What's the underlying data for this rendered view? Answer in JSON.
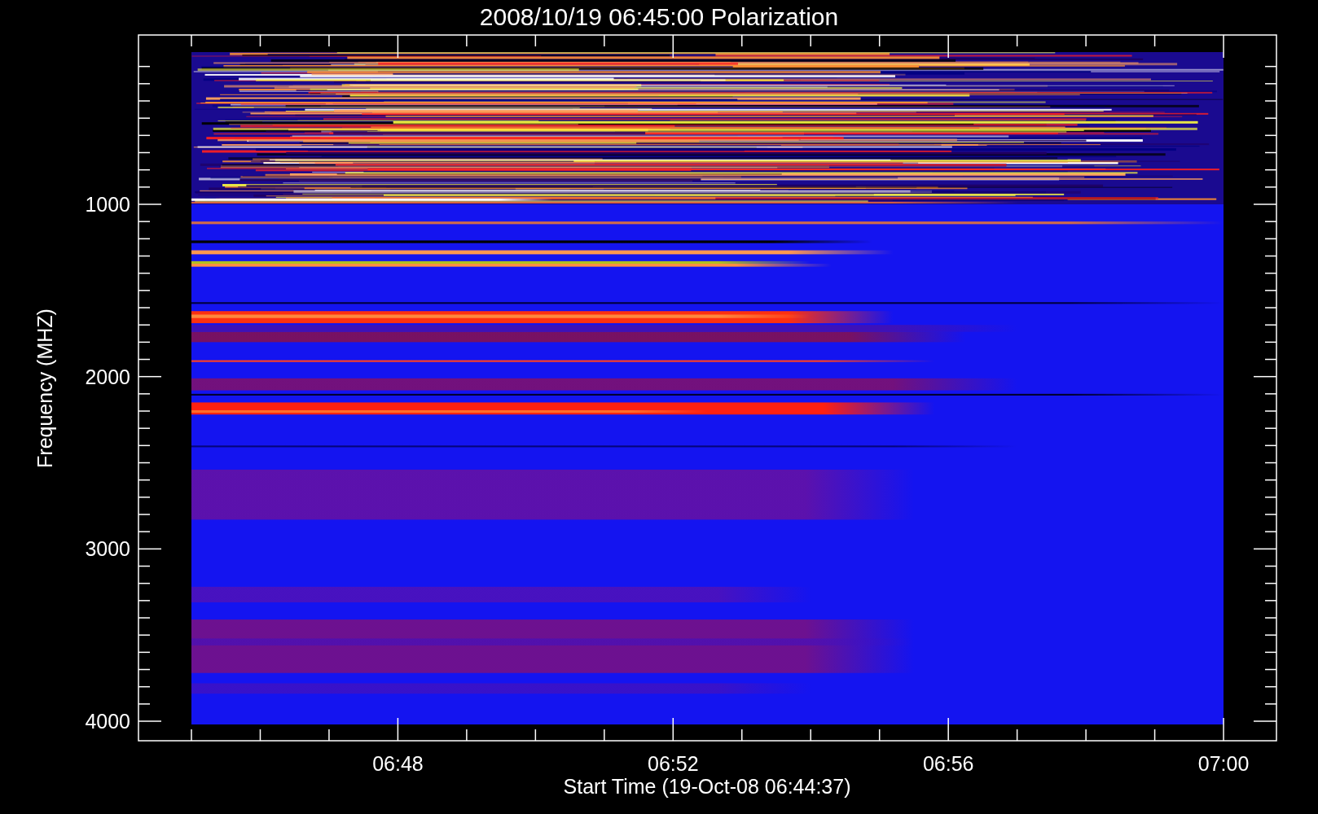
{
  "title": "2008/10/19 06:45:00 Polarization",
  "y_axis": {
    "label": "Frequency (MHZ)",
    "ticks": [
      "1000",
      "2000",
      "3000",
      "4000"
    ]
  },
  "x_axis": {
    "label": "Start Time (19-Oct-08 06:44:37)",
    "ticks": [
      "06:48",
      "06:52",
      "06:56",
      "07:00"
    ]
  }
}
